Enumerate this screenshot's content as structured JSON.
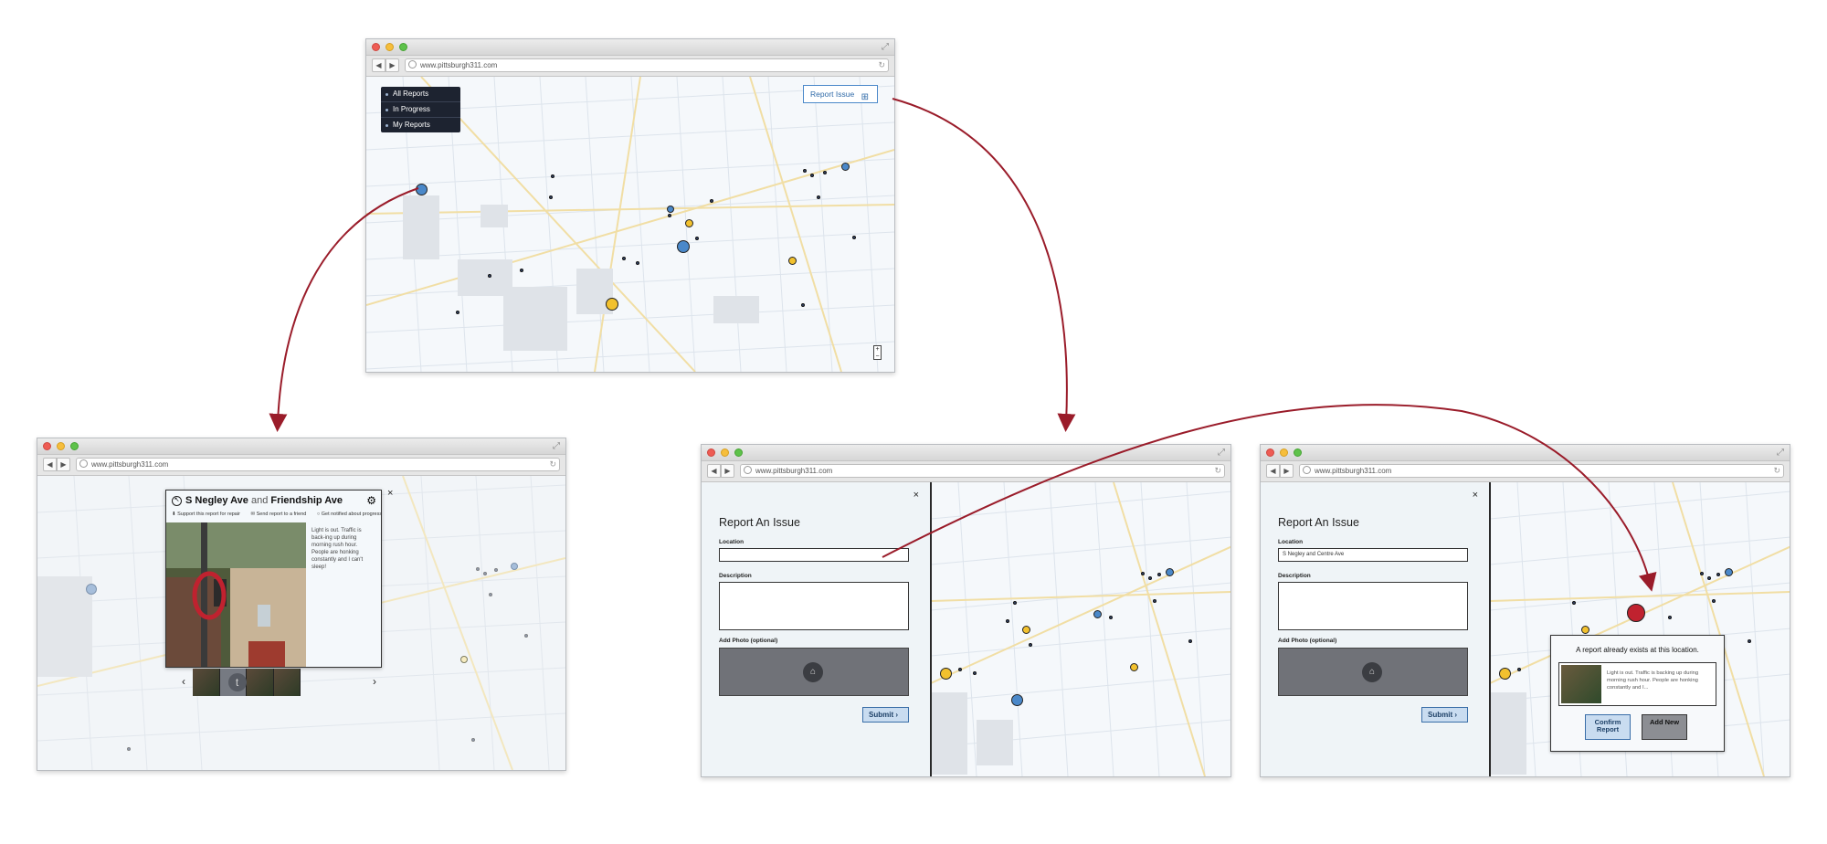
{
  "browser": {
    "url": "www.pittsburgh311.com"
  },
  "main": {
    "filters": [
      "All Reports",
      "In Progress",
      "My Reports"
    ],
    "report_button": "Report Issue"
  },
  "detail": {
    "street_a": "S Negley Ave",
    "and_word": "and",
    "street_b": "Friendship Ave",
    "actions": {
      "support": "Support this report for repair",
      "send": "Send report to a friend",
      "notify": "Get notified about progress"
    },
    "description": "Light is out. Traffic is back-ing up during morning rush hour. People are honking constantly and I can't sleep!",
    "close": "×",
    "carousel_badge": "t"
  },
  "report_form": {
    "title": "Report An Issue",
    "close": "×",
    "location_label": "Location",
    "description_label": "Description",
    "photo_label": "Add Photo (optional)",
    "submit": "Submit",
    "location_value_empty": "",
    "location_value_filled": "S Negley and Centre Ave"
  },
  "duplicate": {
    "title": "A report already exists at this location.",
    "description": "Light is out. Traffic is backing up during morning rush hour. People are honking constantly and I...",
    "confirm": "Confirm Report",
    "add_new": "Add New"
  },
  "colors": {
    "accent_blue": "#4a88c9",
    "pin_yellow": "#f2c12e",
    "pin_red": "#c0222f",
    "arrow": "#9a1c2a"
  }
}
